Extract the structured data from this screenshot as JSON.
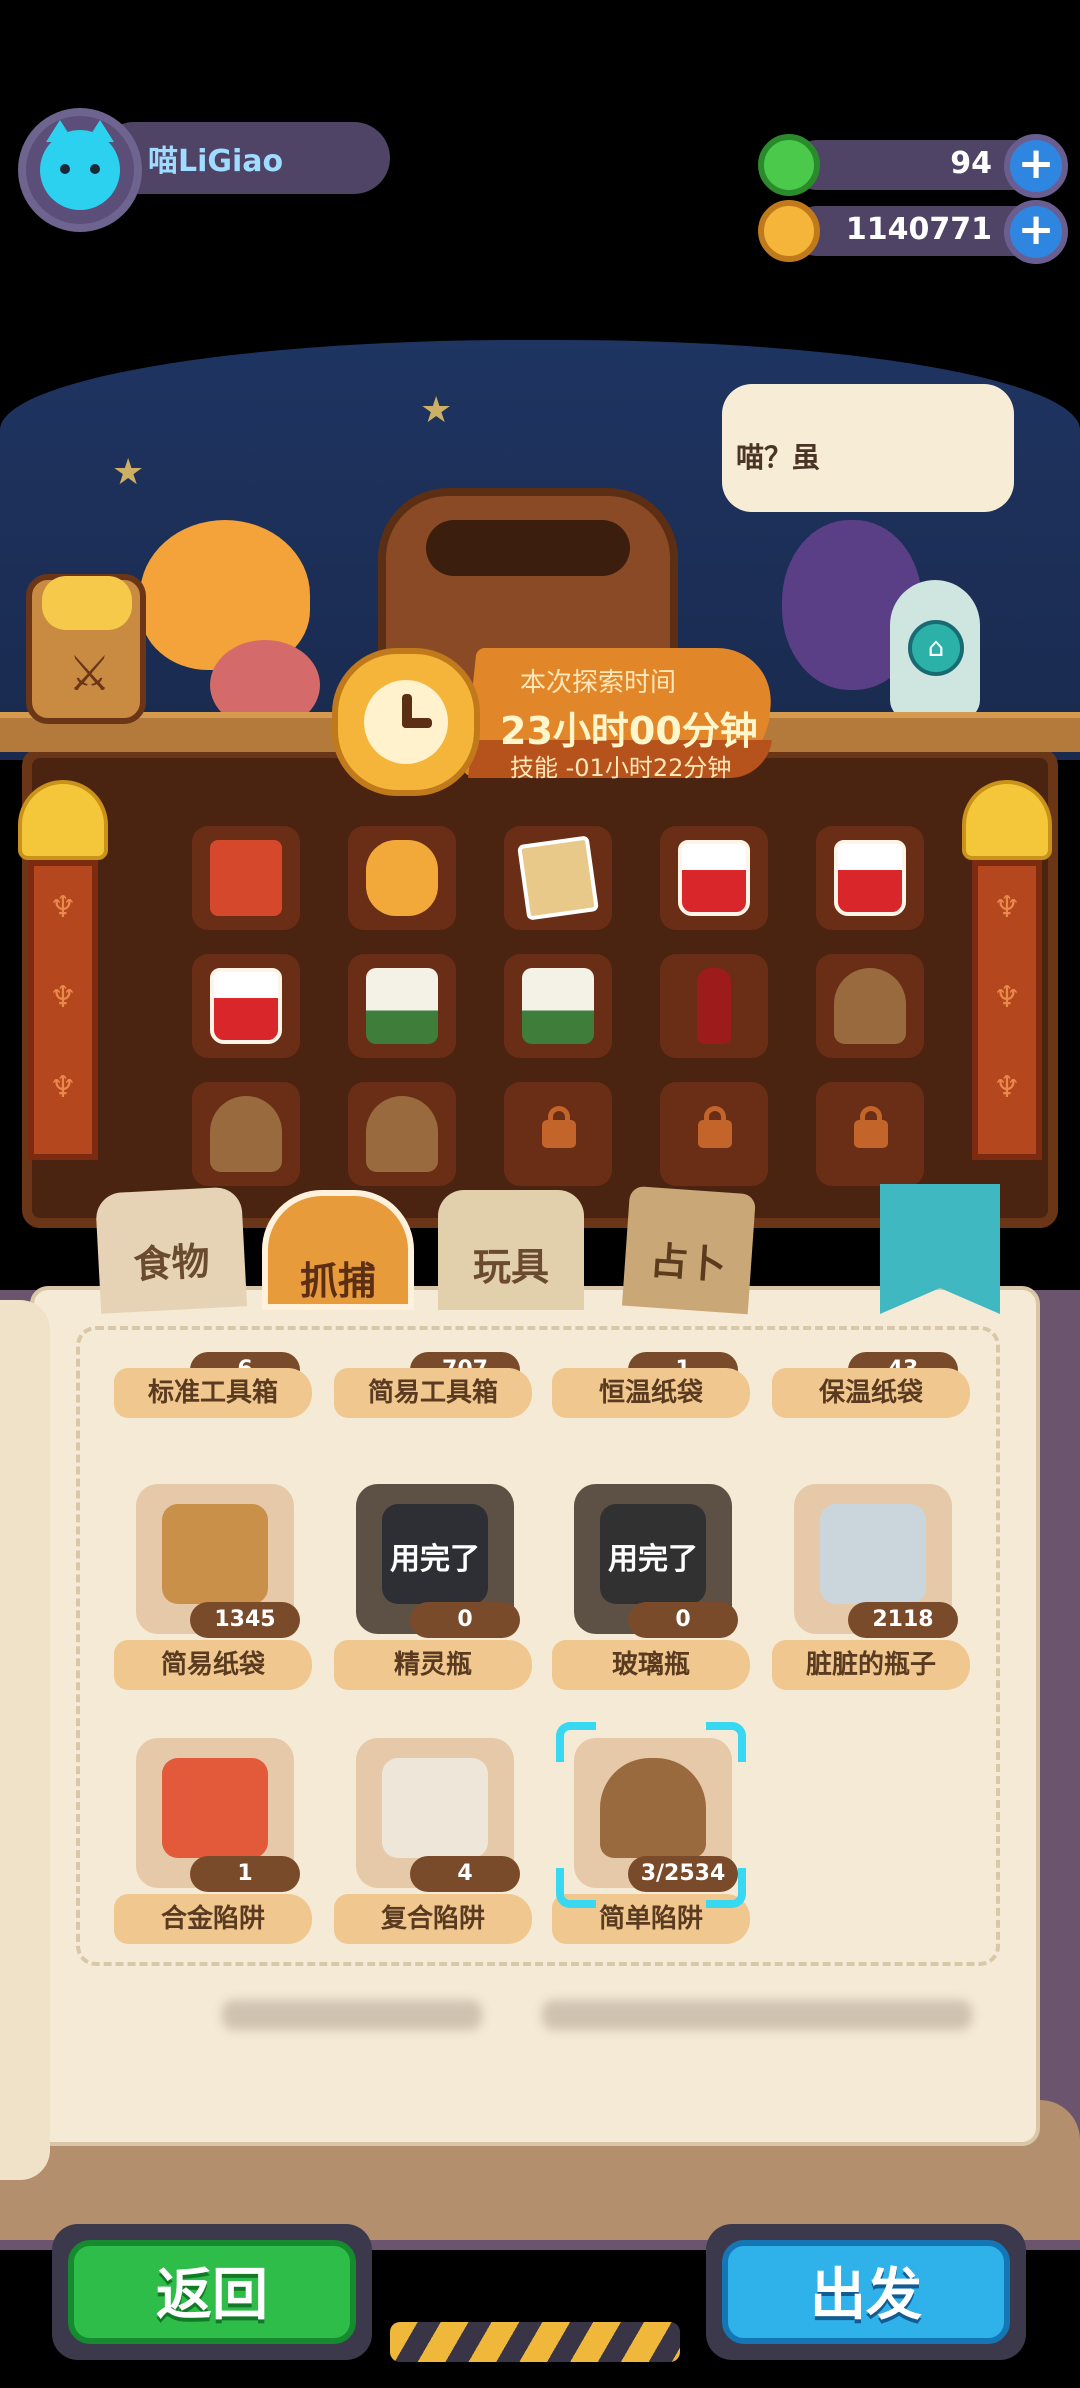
{
  "player": {
    "name": "喵LiGiao"
  },
  "currencies": [
    {
      "icon": "green-gem-coin",
      "value": "94",
      "color": "#4ac94a"
    },
    {
      "icon": "gold-planet-coin",
      "value": "1140771",
      "color": "#f4b53a"
    }
  ],
  "speech": {
    "text": "喵？虽"
  },
  "exploration": {
    "title": "本次探索时间",
    "duration": "23小时00分钟",
    "skill": "技能 -01小时22分钟"
  },
  "backpack_slots": [
    {
      "icon": "lunchbox-icon",
      "locked": false
    },
    {
      "icon": "trumpet-icon",
      "locked": false
    },
    {
      "icon": "cat-card-icon",
      "locked": false
    },
    {
      "icon": "red-potion-icon",
      "locked": false
    },
    {
      "icon": "red-potion-icon",
      "locked": false
    },
    {
      "icon": "red-potion-icon",
      "locked": false
    },
    {
      "icon": "rice-cake-icon",
      "locked": false
    },
    {
      "icon": "rice-cake-icon",
      "locked": false
    },
    {
      "icon": "sauce-bottle-icon",
      "locked": false
    },
    {
      "icon": "trap-helmet-icon",
      "locked": false
    },
    {
      "icon": "trap-helmet-icon",
      "locked": false
    },
    {
      "icon": "trap-helmet-icon",
      "locked": false
    },
    {
      "icon": "lock-icon",
      "locked": true
    },
    {
      "icon": "lock-icon",
      "locked": true
    },
    {
      "icon": "lock-icon",
      "locked": true
    }
  ],
  "tabs": [
    {
      "label": "食物",
      "active": false
    },
    {
      "label": "抓捕",
      "active": true
    },
    {
      "label": "玩具",
      "active": false
    },
    {
      "label": "占卜",
      "active": false
    }
  ],
  "items": {
    "row0": [
      {
        "label": "标准工具箱",
        "count": "6"
      },
      {
        "label": "简易工具箱",
        "count": "707"
      },
      {
        "label": "恒温纸袋",
        "count": "1"
      },
      {
        "label": "保温纸袋",
        "count": "43"
      }
    ],
    "row1": [
      {
        "label": "简易纸袋",
        "count": "1345",
        "used": ""
      },
      {
        "label": "精灵瓶",
        "count": "0",
        "used": "用完了"
      },
      {
        "label": "玻璃瓶",
        "count": "0",
        "used": "用完了"
      },
      {
        "label": "脏脏的瓶子",
        "count": "2118",
        "used": ""
      }
    ],
    "row2": [
      {
        "label": "合金陷阱",
        "count": "1"
      },
      {
        "label": "复合陷阱",
        "count": "4"
      },
      {
        "label": "简单陷阱",
        "count": "3/2534",
        "selected": true
      }
    ]
  },
  "buttons": {
    "back": "返回",
    "go": "出发"
  }
}
